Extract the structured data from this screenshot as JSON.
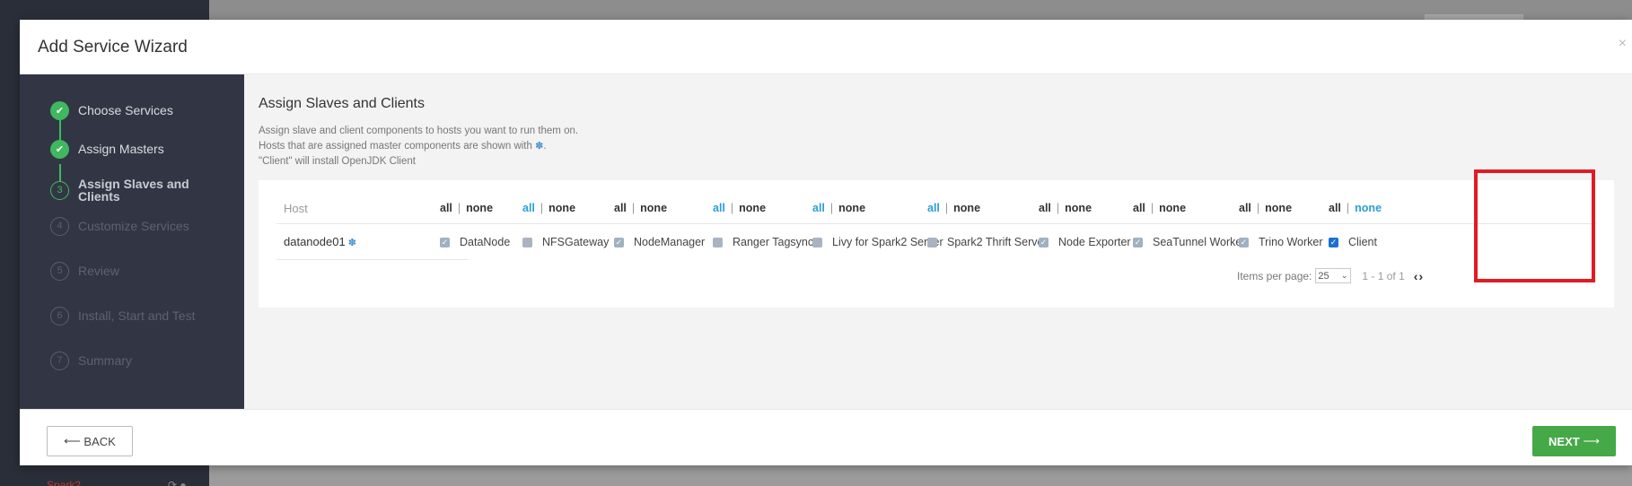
{
  "modal": {
    "title": "Add Service Wizard",
    "close_icon": "×"
  },
  "steps": [
    {
      "marker": "✔",
      "label": "Choose Services",
      "status": "done"
    },
    {
      "marker": "✔",
      "label": "Assign Masters",
      "status": "done"
    },
    {
      "marker": "3",
      "label": "Assign Slaves and Clients",
      "status": "active"
    },
    {
      "marker": "4",
      "label": "Customize Services",
      "status": "todo"
    },
    {
      "marker": "5",
      "label": "Review",
      "status": "todo"
    },
    {
      "marker": "6",
      "label": "Install, Start and Test",
      "status": "todo"
    },
    {
      "marker": "7",
      "label": "Summary",
      "status": "todo"
    }
  ],
  "content": {
    "title": "Assign Slaves and Clients",
    "desc_line1": "Assign slave and client components to hosts you want to run them on.",
    "desc_line2_pre": "Hosts that are assigned master components are shown with ",
    "desc_line2_icon": "✽",
    "desc_line2_post": ".",
    "desc_line3": "\"Client\" will install OpenJDK Client"
  },
  "table": {
    "host_header": "Host",
    "all_label": "all",
    "none_label": "none",
    "sep": "|",
    "host": {
      "name": "datanode01",
      "master_icon": "✽"
    },
    "components": [
      {
        "name": "DataNode",
        "checked": true
      },
      {
        "name": "NFSGateway",
        "checked": false
      },
      {
        "name": "NodeManager",
        "checked": true
      },
      {
        "name": "Ranger Tagsync",
        "checked": false
      },
      {
        "name": "Livy for Spark2 Server",
        "checked": false
      },
      {
        "name": "Spark2 Thrift Server",
        "checked": false
      },
      {
        "name": "Node Exporter",
        "checked": true
      },
      {
        "name": "SeaTunnel Worker",
        "checked": true
      },
      {
        "name": "Trino Worker",
        "checked": true
      },
      {
        "name": "Client",
        "checked": true
      }
    ]
  },
  "pager": {
    "items_per_page_label": "Items per page:",
    "items_per_page_value": "25",
    "range": "1 - 1 of 1",
    "prev_icon": "‹",
    "next_icon": "›"
  },
  "footer": {
    "back_label": "BACK",
    "back_arrow": "⟵",
    "next_label": "NEXT",
    "next_arrow": "⟶"
  },
  "background": {
    "sidebar_item": "Spark2"
  },
  "colors": {
    "accent_green": "#45a947",
    "link_blue": "#2a9fd6",
    "highlight_red": "#e21b23"
  }
}
